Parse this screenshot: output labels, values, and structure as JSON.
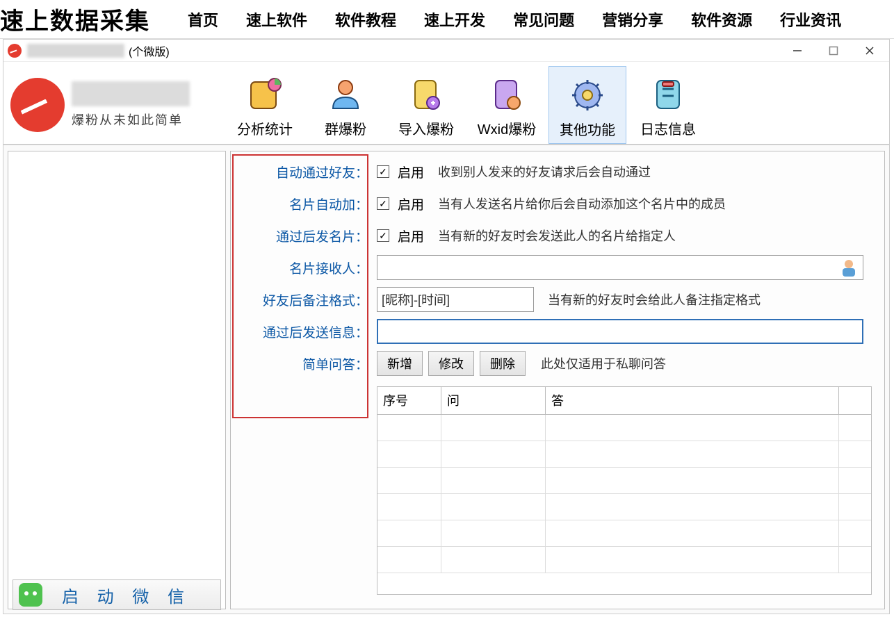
{
  "site": {
    "logo": "速上数据采集",
    "nav": [
      "首页",
      "速上软件",
      "软件教程",
      "速上开发",
      "常见问题",
      "营销分享",
      "软件资源",
      "行业资讯"
    ]
  },
  "window": {
    "title_suffix": "(个微版)"
  },
  "brand": {
    "slogan": "爆粉从未如此简单"
  },
  "toolbar": {
    "items": [
      {
        "id": "stats",
        "label": "分析统计"
      },
      {
        "id": "group",
        "label": "群爆粉"
      },
      {
        "id": "import",
        "label": "导入爆粉"
      },
      {
        "id": "wxid",
        "label": "Wxid爆粉"
      },
      {
        "id": "other",
        "label": "其他功能",
        "active": true
      },
      {
        "id": "log",
        "label": "日志信息"
      }
    ]
  },
  "side": {
    "start_wechat": "启 动 微 信"
  },
  "form": {
    "auto_pass": {
      "label": "自动通过好友：",
      "enable": "启用",
      "checked": true,
      "hint": "收到别人发来的好友请求后会自动通过"
    },
    "card_auto_add": {
      "label": "名片自动加：",
      "enable": "启用",
      "checked": true,
      "hint": "当有人发送名片给你后会自动添加这个名片中的成员"
    },
    "send_card_after": {
      "label": "通过后发名片：",
      "enable": "启用",
      "checked": true,
      "hint": "当有新的好友时会发送此人的名片给指定人"
    },
    "card_recipient": {
      "label": "名片接收人：",
      "value": ""
    },
    "remark_format": {
      "label": "好友后备注格式：",
      "value": "[昵称]-[时间]",
      "hint": "当有新的好友时会给此人备注指定格式"
    },
    "send_msg_after": {
      "label": "通过后发送信息：",
      "value": ""
    },
    "qa": {
      "label": "简单问答：",
      "btn_add": "新增",
      "btn_edit": "修改",
      "btn_del": "删除",
      "hint": "此处仅适用于私聊问答",
      "columns": {
        "seq": "序号",
        "q": "问",
        "a": "答"
      }
    }
  }
}
